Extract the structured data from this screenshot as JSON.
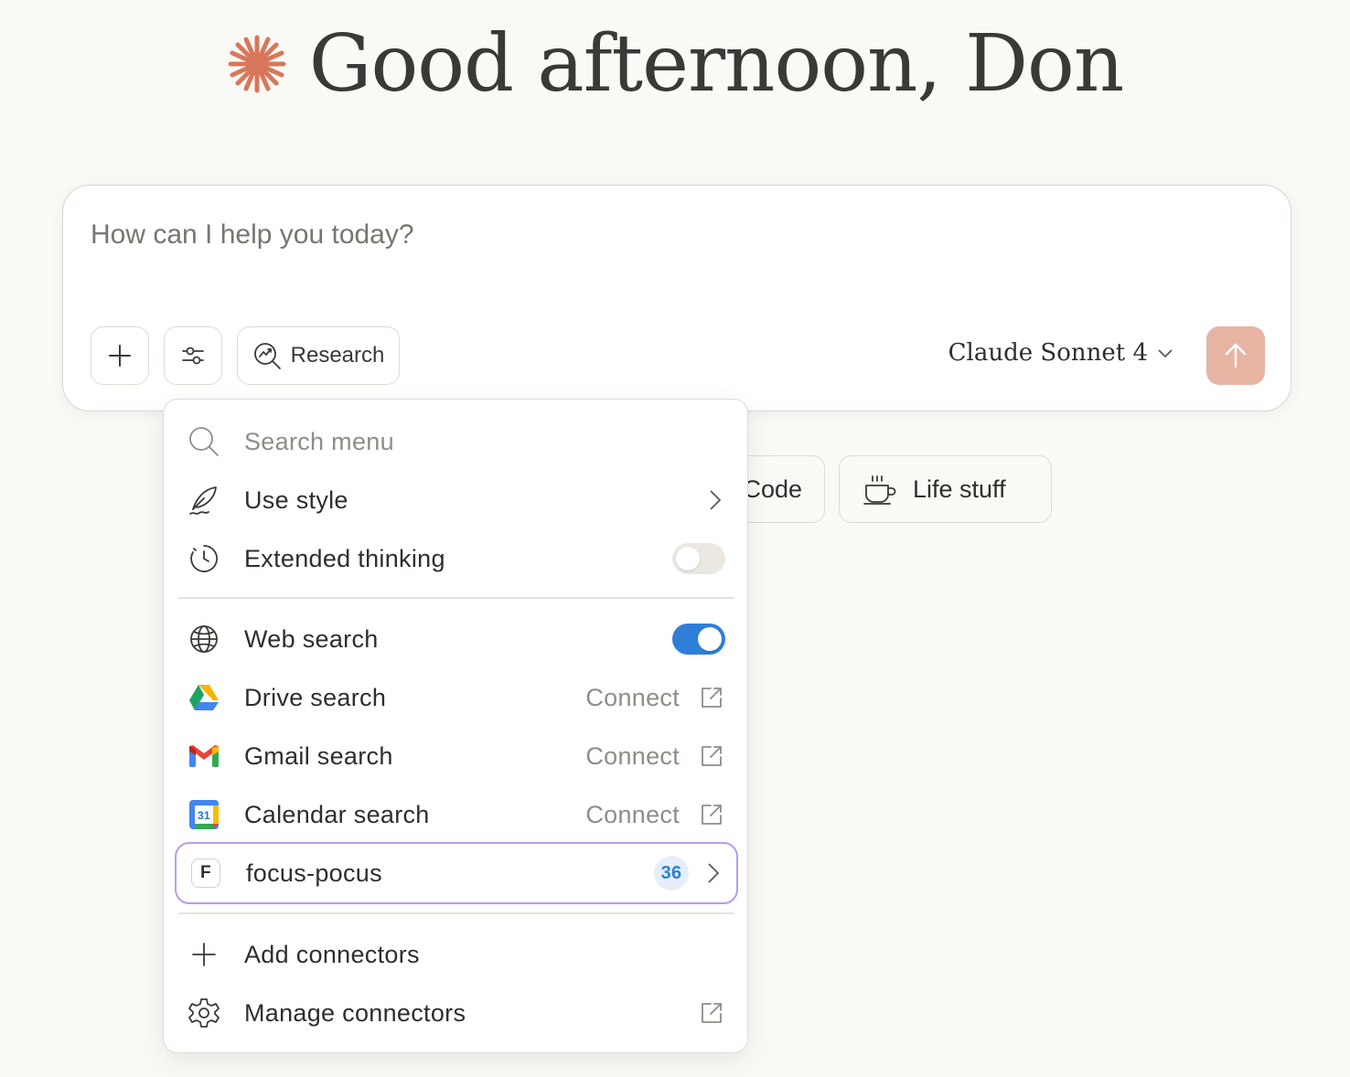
{
  "greeting": {
    "text": "Good afternoon, Don",
    "icon": "spark-icon",
    "icon_color": "#d9775a"
  },
  "composer": {
    "placeholder": "How can I help you today?",
    "research_label": "Research",
    "model_label": "Claude Sonnet 4",
    "send_color": "#e7b4a4"
  },
  "chips": [
    {
      "label": "Code"
    },
    {
      "label": "Life stuff",
      "icon": "coffee-cup-icon"
    }
  ],
  "menu": {
    "search_placeholder": "Search menu",
    "items": {
      "use_style": {
        "label": "Use style"
      },
      "extended_thinking": {
        "label": "Extended thinking",
        "enabled": false
      },
      "web_search": {
        "label": "Web search",
        "enabled": true
      },
      "drive_search": {
        "label": "Drive search",
        "action": "Connect"
      },
      "gmail_search": {
        "label": "Gmail search",
        "action": "Connect"
      },
      "calendar_search": {
        "label": "Calendar search",
        "action": "Connect",
        "icon_text": "31"
      },
      "focus_pocus": {
        "label": "focus-pocus",
        "tile_letter": "F",
        "count": "36"
      },
      "add_connectors": {
        "label": "Add connectors"
      },
      "manage_connectors": {
        "label": "Manage connectors"
      }
    },
    "toggle_on_color": "#2f7fd9",
    "highlight_color": "#b99af0"
  }
}
